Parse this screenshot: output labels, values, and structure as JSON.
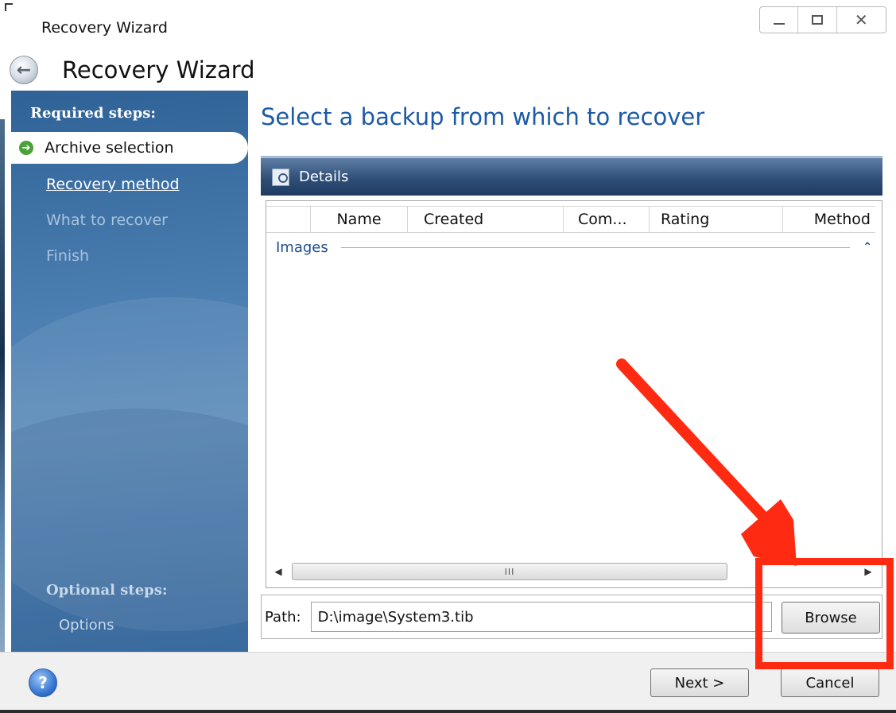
{
  "window": {
    "title": "Recovery Wizard"
  },
  "header": {
    "title": "Recovery Wizard"
  },
  "sidebar": {
    "required_heading": "Required steps:",
    "steps": [
      {
        "label": "Archive selection",
        "state": "current"
      },
      {
        "label": "Recovery method",
        "state": "link"
      },
      {
        "label": "What to recover",
        "state": "disabled"
      },
      {
        "label": "Finish",
        "state": "disabled"
      }
    ],
    "optional_heading": "Optional steps:",
    "optional_steps": [
      {
        "label": "Options"
      }
    ]
  },
  "main": {
    "title": "Select a backup from which to recover",
    "details_label": "Details",
    "columns": [
      "Name",
      "Created",
      "Com...",
      "Rating",
      "Method"
    ],
    "group_label": "Images",
    "scroll_thumb": "III",
    "path_label": "Path:",
    "path_value": "D:\\image\\System3.tib",
    "browse_label": "Browse"
  },
  "footer": {
    "next_label": "Next >",
    "cancel_label": "Cancel"
  },
  "colors": {
    "accent_title": "#1b5aa6",
    "sidebar_blue": "#4c7fb2",
    "annotation_red": "#ff2a12"
  },
  "icons": {
    "back": "back-arrow-icon",
    "details": "details-magnifier-icon",
    "help": "help-icon",
    "current_step": "green-arrow-icon"
  }
}
